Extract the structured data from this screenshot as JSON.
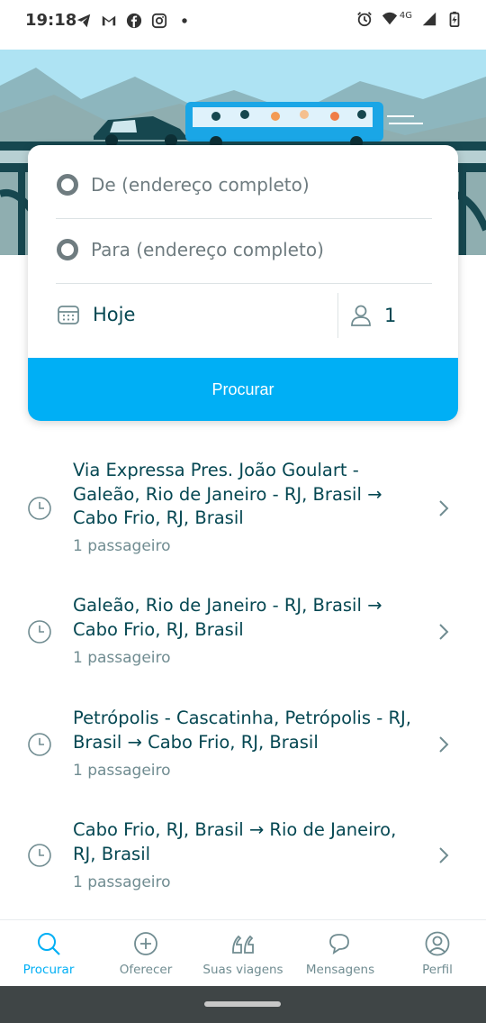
{
  "status_bar": {
    "time": "19:18",
    "network": "4G",
    "left_icons": [
      "telegram-icon",
      "gmail-icon",
      "facebook-icon",
      "instagram-icon",
      "dot-icon"
    ],
    "right_icons": [
      "alarm-icon",
      "wifi-icon",
      "signal-icon",
      "battery-icon"
    ]
  },
  "search": {
    "from_placeholder": "De (endereço completo)",
    "to_placeholder": "Para (endereço completo)",
    "date": "Hoje",
    "passengers": "1",
    "button_label": "Procurar"
  },
  "recent_searches": [
    {
      "route_line1": "Via Expressa Pres. João Goulart -",
      "route_line2": "Galeão, Rio de Janeiro - RJ, Brasil →",
      "route_line3": "Cabo Frio, RJ, Brasil",
      "passengers": "1 passageiro"
    },
    {
      "route_line1": "Galeão, Rio de Janeiro - RJ, Brasil →",
      "route_line2": "Cabo Frio, RJ, Brasil",
      "passengers": "1 passageiro"
    },
    {
      "route_line1": "Petrópolis - Cascatinha, Petrópolis - RJ,",
      "route_line2": "Brasil → Cabo Frio, RJ, Brasil",
      "passengers": "1 passageiro"
    },
    {
      "route_line1": "Cabo Frio, RJ, Brasil → Rio de Janeiro,",
      "route_line2": "RJ, Brasil",
      "passengers": "1 passageiro"
    }
  ],
  "bottom_nav": {
    "search": "Procurar",
    "offer": "Oferecer",
    "trips": "Suas viagens",
    "messages": "Mensagens",
    "profile": "Perfil"
  },
  "colors": {
    "primary": "#00aff5",
    "text": "#054752",
    "muted": "#708c91"
  }
}
